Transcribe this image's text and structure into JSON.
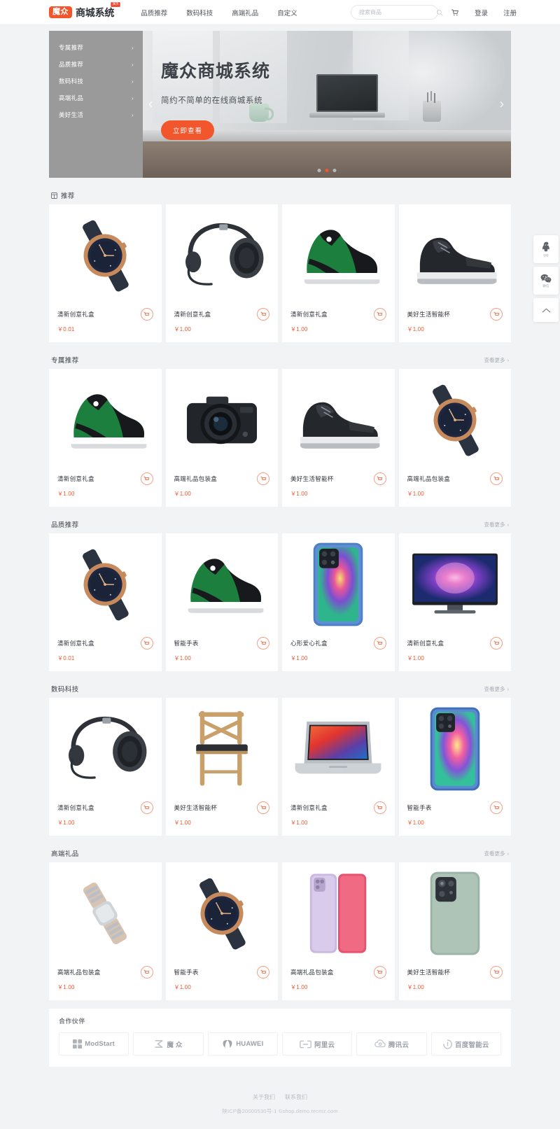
{
  "header": {
    "logo_badge": "魔众",
    "logo_text": "商城系统",
    "logo_tag": "演示",
    "nav": [
      {
        "label": "品质推荐"
      },
      {
        "label": "数码科技"
      },
      {
        "label": "高端礼品"
      },
      {
        "label": "自定义"
      }
    ],
    "search_placeholder": "搜索商品",
    "search_value": "",
    "cart_icon": "cart-icon",
    "login": "登录",
    "register": "注册"
  },
  "hero": {
    "categories": [
      {
        "label": "专属推荐"
      },
      {
        "label": "品质推荐"
      },
      {
        "label": "数码科技"
      },
      {
        "label": "高端礼品"
      },
      {
        "label": "美好生活"
      }
    ],
    "title": "魔众商城系统",
    "subtitle": "简约不简单的在线商城系统",
    "button": "立即查看",
    "arrow_prev": "‹",
    "arrow_next": "›",
    "slides": 3,
    "active_slide": 2
  },
  "sections": [
    {
      "title": "推荐",
      "icon": "grid-icon",
      "more": "",
      "products": [
        {
          "name": "清新创意礼盒",
          "price": "￥0.01",
          "image": "watch"
        },
        {
          "name": "清新创意礼盒",
          "price": "￥1.00",
          "image": "headphones"
        },
        {
          "name": "清新创意礼盒",
          "price": "￥1.00",
          "image": "sneaker-green"
        },
        {
          "name": "美好生活智能杯",
          "price": "￥1.00",
          "image": "boot-black"
        }
      ]
    },
    {
      "title": "专属推荐",
      "icon": "",
      "more": "查看更多",
      "products": [
        {
          "name": "清新创意礼盒",
          "price": "￥1.00",
          "image": "sneaker-green"
        },
        {
          "name": "高端礼品包装盒",
          "price": "￥1.00",
          "image": "camera"
        },
        {
          "name": "美好生活智能杯",
          "price": "￥1.00",
          "image": "boot-black"
        },
        {
          "name": "高端礼品包装盒",
          "price": "￥1.00",
          "image": "watch"
        }
      ]
    },
    {
      "title": "品质推荐",
      "icon": "",
      "more": "查看更多",
      "products": [
        {
          "name": "清新创意礼盒",
          "price": "￥0.01",
          "image": "watch"
        },
        {
          "name": "智能手表",
          "price": "￥1.00",
          "image": "sneaker-green"
        },
        {
          "name": "心形爱心礼盒",
          "price": "￥1.00",
          "image": "phone-colorful"
        },
        {
          "name": "清新创意礼盒",
          "price": "￥1.00",
          "image": "tv"
        }
      ]
    },
    {
      "title": "数码科技",
      "icon": "",
      "more": "查看更多",
      "products": [
        {
          "name": "清新创意礼盒",
          "price": "￥1.00",
          "image": "headphones"
        },
        {
          "name": "美好生活智能杯",
          "price": "￥1.00",
          "image": "chair"
        },
        {
          "name": "清新创意礼盒",
          "price": "￥1.00",
          "image": "laptop"
        },
        {
          "name": "智能手表",
          "price": "￥1.00",
          "image": "phone-blue"
        }
      ]
    },
    {
      "title": "高端礼品",
      "icon": "",
      "more": "查看更多",
      "products": [
        {
          "name": "高端礼品包装盒",
          "price": "￥1.00",
          "image": "watch-silver"
        },
        {
          "name": "智能手表",
          "price": "￥1.00",
          "image": "watch"
        },
        {
          "name": "高端礼品包装盒",
          "price": "￥1.00",
          "image": "phone-pink"
        },
        {
          "name": "美好生活智能杯",
          "price": "￥1.00",
          "image": "phone-green"
        }
      ]
    }
  ],
  "partners": {
    "title": "合作伙伴",
    "items": [
      {
        "name": "ModStart",
        "icon": "modstart-icon"
      },
      {
        "name": "魔 众",
        "icon": "mozhong-icon"
      },
      {
        "name": "HUAWEI",
        "icon": "huawei-icon"
      },
      {
        "name": "阿里云",
        "icon": "aliyun-icon"
      },
      {
        "name": "腾讯云",
        "icon": "tencent-icon"
      },
      {
        "name": "百度智能云",
        "icon": "baidu-icon"
      }
    ]
  },
  "floaty": [
    {
      "name": "qq",
      "label": "QQ"
    },
    {
      "name": "wechat",
      "label": "微信"
    },
    {
      "name": "backtotop",
      "label": ""
    }
  ],
  "footer": {
    "links": [
      {
        "label": "关于我们"
      },
      {
        "label": "联系我们"
      }
    ],
    "copyright": "陕ICP备20000530号-1 ©shop.demo.tecmz.com"
  },
  "colors": {
    "accent": "#f1562c",
    "page_bg": "#f2f3f5",
    "card_bg": "#ffffff"
  }
}
